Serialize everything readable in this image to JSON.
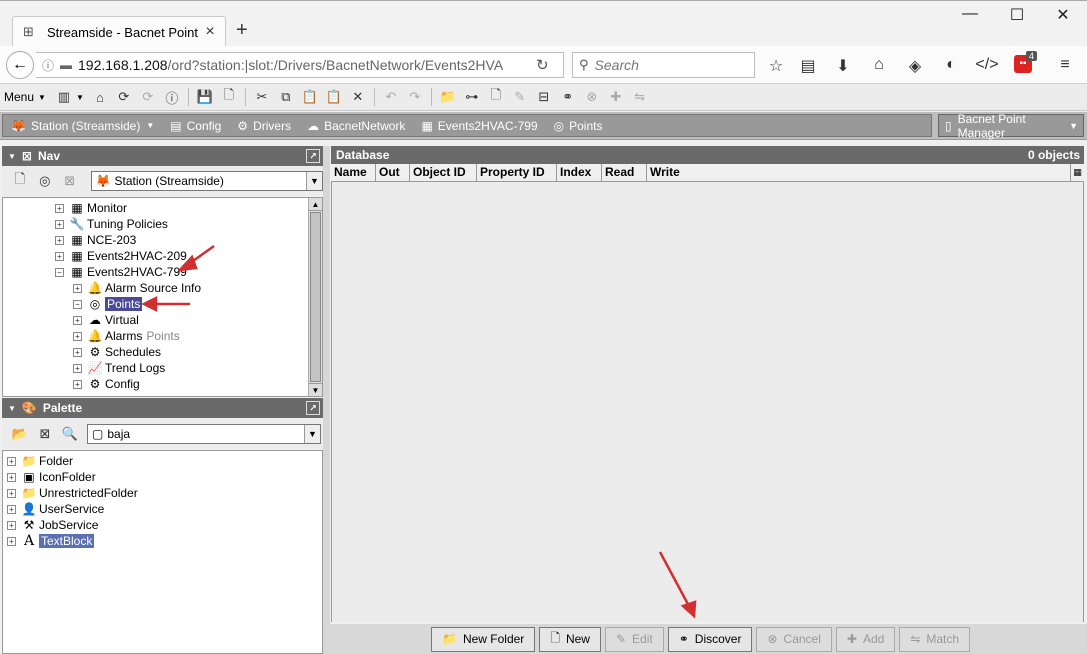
{
  "browser": {
    "tab_title": "Streamside - Bacnet Point ...",
    "url_host": "192.168.1.208",
    "url_path": "/ord?station:|slot:/Drivers/BacnetNetwork/Events2HVA",
    "search_placeholder": "Search",
    "badge_count": "4"
  },
  "toolbar": {
    "menu_label": "Menu"
  },
  "locator": {
    "crumbs": [
      "Station (Streamside)",
      "Config",
      "Drivers",
      "BacnetNetwork",
      "Events2HVAC-799",
      "Points"
    ],
    "view": "Bacnet Point Manager"
  },
  "nav": {
    "title": "Nav",
    "station_combo": "Station (Streamside)",
    "tree": [
      {
        "label": "Monitor",
        "icon": "monitor-icon"
      },
      {
        "label": "Tuning Policies",
        "icon": "wrench-icon"
      },
      {
        "label": "NCE-203",
        "icon": "device-icon"
      },
      {
        "label": "Events2HVAC-209",
        "icon": "device-icon"
      },
      {
        "label": "Events2HVAC-799",
        "icon": "device-icon"
      },
      {
        "label": "Alarm Source Info",
        "icon": "bell-icon"
      },
      {
        "label": "Points",
        "icon": "points-icon"
      },
      {
        "label": "Virtual",
        "icon": "virtual-icon"
      },
      {
        "label": "Alarms",
        "icon": "bell-icon"
      },
      {
        "label": "Schedules",
        "icon": "schedule-icon"
      },
      {
        "label": "Trend Logs",
        "icon": "trend-icon"
      },
      {
        "label": "Config",
        "icon": "gear-icon"
      }
    ],
    "drag_ghost": "Points"
  },
  "palette": {
    "title": "Palette",
    "module_combo": "baja",
    "items": [
      "Folder",
      "IconFolder",
      "UnrestrictedFolder",
      "UserService",
      "JobService",
      "TextBlock"
    ]
  },
  "database": {
    "title": "Database",
    "count": "0 objects",
    "columns": [
      "Name",
      "Out",
      "Object ID",
      "Property ID",
      "Index",
      "Read",
      "Write"
    ]
  },
  "buttons": {
    "new_folder": "New Folder",
    "new": "New",
    "edit": "Edit",
    "discover": "Discover",
    "cancel": "Cancel",
    "add": "Add",
    "match": "Match"
  },
  "colors": {
    "annotation_arrow": "#d03030",
    "selection": "#4a4a9a"
  }
}
